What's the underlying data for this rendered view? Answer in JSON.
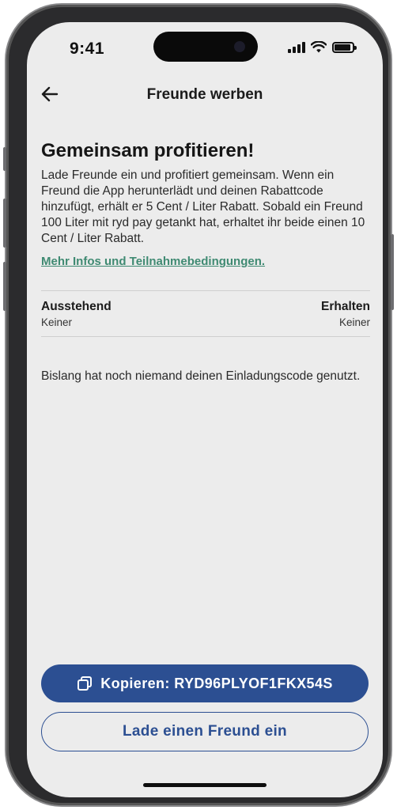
{
  "status_bar": {
    "time": "9:41"
  },
  "nav": {
    "title": "Freunde werben"
  },
  "intro": {
    "headline": "Gemeinsam profitieren!",
    "description": "Lade Freunde ein und profitiert gemeinsam. Wenn ein Freund die App herunterlädt und deinen Rabattcode hinzufügt, erhält er 5 Cent / Liter Rabatt. Sobald ein Freund 100 Liter mit ryd pay getankt hat, erhaltet ihr beide einen 10 Cent / Liter Rabatt.",
    "link": "Mehr Infos und Teilnahmebedingungen."
  },
  "stats": {
    "pending_label": "Ausstehend",
    "pending_value": "Keiner",
    "received_label": "Erhalten",
    "received_value": "Keiner"
  },
  "empty_state": "Bislang hat noch niemand deinen Einladungscode genutzt.",
  "actions": {
    "copy_label": "Kopieren: RYD96PLYOF1FKX54S",
    "invite_label": "Lade einen Freund ein"
  },
  "colors": {
    "primary": "#2c4f92",
    "link": "#3f8a72",
    "background": "#ececec"
  },
  "icons": [
    "back-arrow-icon",
    "copy-icon",
    "signal-icon",
    "wifi-icon",
    "battery-icon"
  ]
}
